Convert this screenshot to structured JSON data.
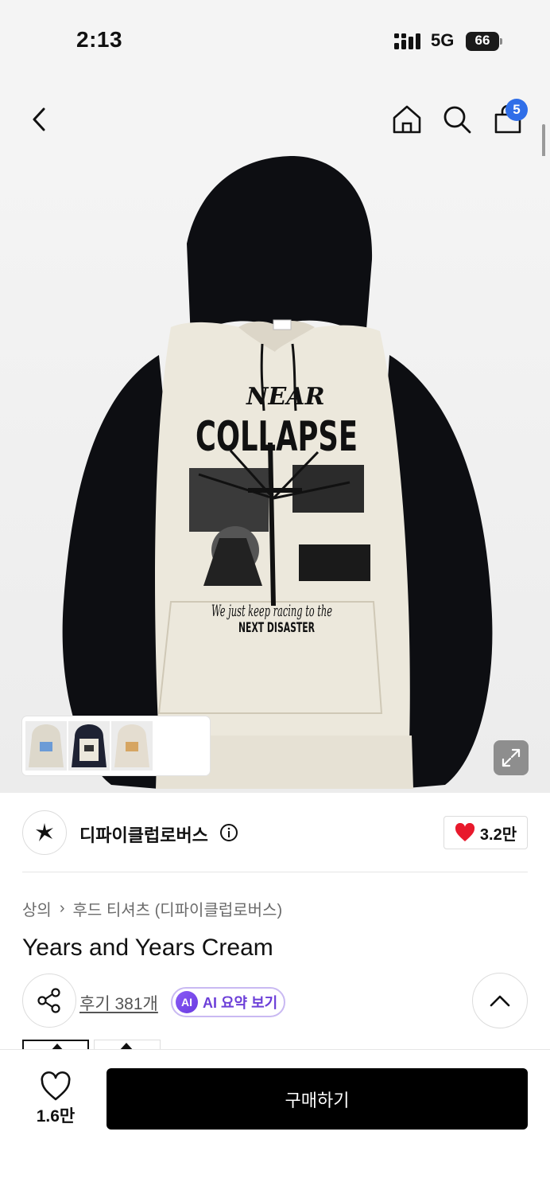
{
  "status_bar": {
    "time": "2:13",
    "network": "5G",
    "battery": "66"
  },
  "nav": {
    "cart_count": "5",
    "icons": [
      "back-icon",
      "home-icon",
      "search-icon",
      "cart-icon"
    ]
  },
  "hero": {
    "print_lines": [
      "NEAR",
      "COLLAPSE",
      "We just keep racing to the",
      "NEXT DISASTER"
    ]
  },
  "brand": {
    "name": "디파이클럽로버스",
    "likes": "3.2만"
  },
  "breadcrumb": {
    "category": "상의",
    "separator": "›",
    "subcategory": "후드 티셔츠 (디파이클럽로버스)"
  },
  "product": {
    "title": "Years and Years Cream"
  },
  "actions": {
    "reviews": "후기 381개",
    "ai_badge": "AI",
    "ai_label": "AI 요약 보기"
  },
  "bottom": {
    "wish_count": "1.6만",
    "buy_label": "구매하기"
  },
  "colors": {
    "accent_blue": "#2f6ee8",
    "heart_red": "#e8192c",
    "ai_purple": "#6c3fd8"
  }
}
